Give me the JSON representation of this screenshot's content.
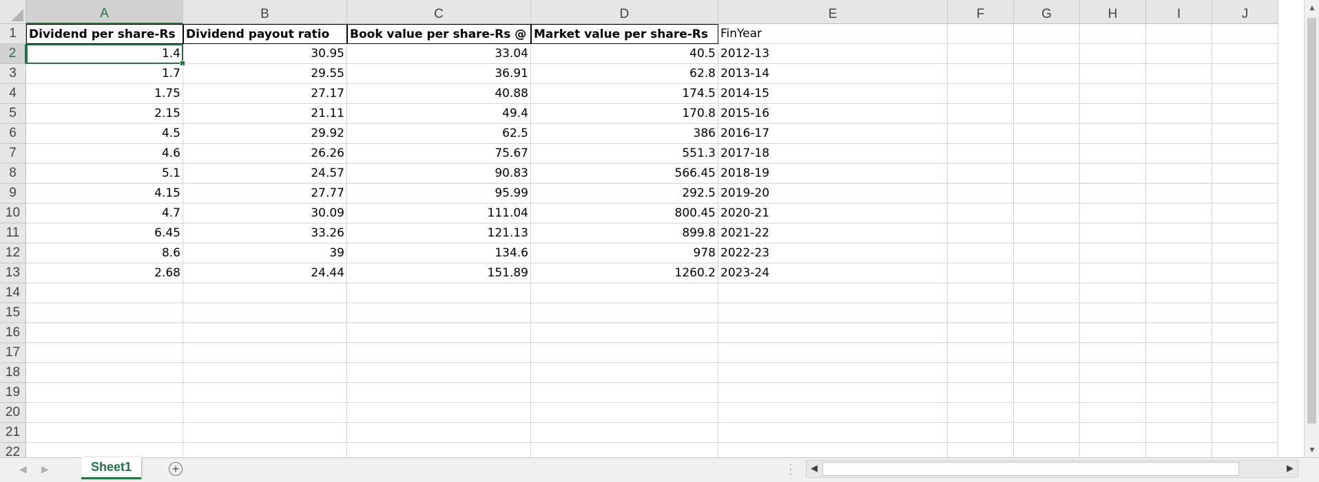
{
  "columns": [
    "A",
    "B",
    "C",
    "D",
    "E",
    "F",
    "G",
    "H",
    "I",
    "J"
  ],
  "active_column": "A",
  "active_row": 2,
  "header_row": [
    "Dividend per share-Rs",
    "Dividend payout ratio",
    "Book value per share-Rs @",
    "Market value per share-Rs",
    "FinYear"
  ],
  "data_rows": [
    [
      "1.4",
      "30.95",
      "33.04",
      "40.5",
      "2012-13"
    ],
    [
      "1.7",
      "29.55",
      "36.91",
      "62.8",
      "2013-14"
    ],
    [
      "1.75",
      "27.17",
      "40.88",
      "174.5",
      "2014-15"
    ],
    [
      "2.15",
      "21.11",
      "49.4",
      "170.8",
      "2015-16"
    ],
    [
      "4.5",
      "29.92",
      "62.5",
      "386",
      "2016-17"
    ],
    [
      "4.6",
      "26.26",
      "75.67",
      "551.3",
      "2017-18"
    ],
    [
      "5.1",
      "24.57",
      "90.83",
      "566.45",
      "2018-19"
    ],
    [
      "4.15",
      "27.77",
      "95.99",
      "292.5",
      "2019-20"
    ],
    [
      "4.7",
      "30.09",
      "111.04",
      "800.45",
      "2020-21"
    ],
    [
      "6.45",
      "33.26",
      "121.13",
      "899.8",
      "2021-22"
    ],
    [
      "8.6",
      "39",
      "134.6",
      "978",
      "2022-23"
    ],
    [
      "2.68",
      "24.44",
      "151.89",
      "1260.2",
      "2023-24"
    ]
  ],
  "row_numbers": [
    "1",
    "2",
    "3",
    "4",
    "5",
    "6",
    "7",
    "8",
    "9",
    "10",
    "11",
    "12",
    "13",
    "14",
    "15",
    "16",
    "17",
    "18",
    "19",
    "20",
    "21",
    "22"
  ],
  "sheet_tab": "Sheet1",
  "accent_color": "#217346",
  "icons": {
    "add_sheet": "plus-circle-icon",
    "prev_sheet": "chevron-left-icon",
    "next_sheet": "chevron-right-icon"
  }
}
